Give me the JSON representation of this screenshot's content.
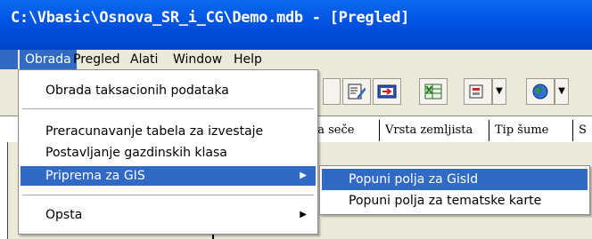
{
  "window": {
    "title": "C:\\Vbasic\\Osnova_SR_i_CG\\Demo.mdb - [Pregled]"
  },
  "menubar": {
    "items": [
      {
        "label": "Obrada",
        "active": true
      },
      {
        "label": "Pregled"
      },
      {
        "label": "Alati"
      },
      {
        "label": "Window"
      },
      {
        "label": "Help"
      }
    ]
  },
  "tabs": [
    {
      "label": "ta seče"
    },
    {
      "label": "Vrsta zemljista"
    },
    {
      "label": "Tip šume"
    },
    {
      "label": "S"
    }
  ],
  "dropdown": {
    "items": [
      {
        "label": "Obrada taksacionih podataka"
      },
      {
        "label": "Preracunavanje tabela za izvestaje"
      },
      {
        "label": "Postavljanje gazdinskih klasa"
      },
      {
        "label": "Priprema za GIS",
        "highlighted": true,
        "submenu": true
      },
      {
        "label": "Opsta",
        "submenu": true
      }
    ],
    "arrow_glyph": "▶"
  },
  "submenu": {
    "items": [
      {
        "label": "Popuni polja za GisId",
        "highlighted": true
      },
      {
        "label": "Popuni polja za tematske karte"
      }
    ]
  },
  "colors": {
    "title_blue": "#0054e3",
    "highlight": "#316ac5",
    "menu_bg": "#ece9d8"
  }
}
